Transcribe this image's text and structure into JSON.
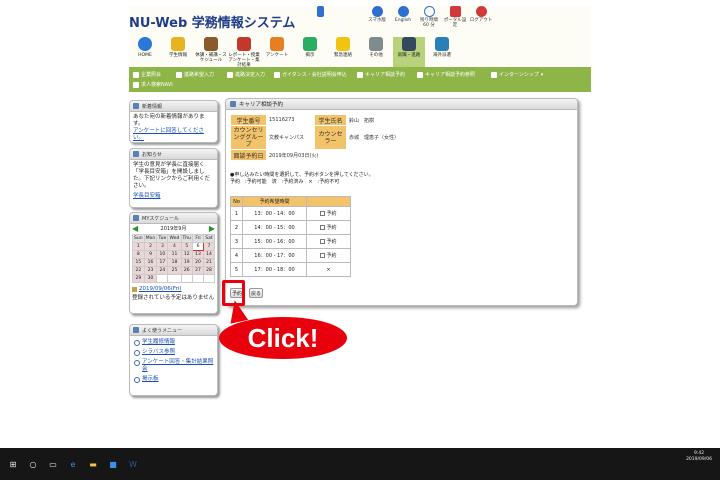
{
  "header": {
    "brand": "NU-Web 学務情報システム",
    "tools": [
      {
        "label": "スマホ版",
        "icon": "smartphone-icon",
        "color": "#2f6fd0"
      },
      {
        "label": "English",
        "icon": "globe-icon",
        "color": "#2f6fd0"
      },
      {
        "label": "残り時間 60 分",
        "icon": "clock-icon",
        "color": "#2f6fd0"
      },
      {
        "label": "ポータル設定",
        "icon": "portal-settings-icon",
        "color": "#d23a3a"
      },
      {
        "label": "ログアウト",
        "icon": "logout-icon",
        "color": "#d23a3a"
      }
    ],
    "nav": [
      {
        "label": "HOME",
        "icon": "home-icon",
        "color": "#2a78d8"
      },
      {
        "label": "学生情報",
        "icon": "student-info-icon",
        "color": "#e6b422"
      },
      {
        "label": "休講・補講・スケジュール",
        "icon": "schedule-icon",
        "color": "#8b5a2b"
      },
      {
        "label": "レポート・授業アンケート・集計結果",
        "icon": "report-icon",
        "color": "#c0392b"
      },
      {
        "label": "アンケート",
        "icon": "survey-icon",
        "color": "#e67e22"
      },
      {
        "label": "掲示",
        "icon": "notice-icon",
        "color": "#27ae60"
      },
      {
        "label": "緊急連絡",
        "icon": "emergency-icon",
        "color": "#f1c40f"
      },
      {
        "label": "その他",
        "icon": "other-icon",
        "color": "#7f8c8d"
      },
      {
        "label": "就職・進路",
        "icon": "career-icon",
        "color": "#34495e"
      },
      {
        "label": "海外派遣",
        "icon": "overseas-icon",
        "color": "#2980b9"
      }
    ]
  },
  "subnav": [
    "企業照会",
    "進路希望入力",
    "進路決定入力",
    "ガイダンス・会社説明会申込",
    "キャリア相談予約",
    "キャリア相談予約参照",
    "インターンシップ",
    "求人検索NAVI"
  ],
  "news": {
    "title": "新着情報",
    "text": "あなた宛の新着情報があります。",
    "link": "アンケートに回答してください。"
  },
  "notice": {
    "title": "お知らせ",
    "text": "学生の意見が学長に直接届く「学長目安箱」を開設しました。下記リンクからご利用ください。",
    "link": "学長目安箱"
  },
  "schedule": {
    "title": "MYスケジュール",
    "month": "2019年9月",
    "weekdays": [
      "Sun",
      "Mon",
      "Tue",
      "Wed",
      "Thu",
      "Fri",
      "Sat"
    ],
    "weeks": [
      [
        "1",
        "2",
        "3",
        "4",
        "5",
        "6",
        "7"
      ],
      [
        "8",
        "9",
        "10",
        "11",
        "12",
        "13",
        "14"
      ],
      [
        "15",
        "16",
        "17",
        "18",
        "19",
        "20",
        "21"
      ],
      [
        "22",
        "23",
        "24",
        "25",
        "26",
        "27",
        "28"
      ],
      [
        "29",
        "30",
        "",
        "",
        "",
        "",
        ""
      ]
    ],
    "date_link": "2019/09/06(Fri)",
    "empty_text": "登録されている予定はありません"
  },
  "menu": {
    "title": "よく使うメニュー",
    "items": [
      "学生履修情報",
      "シラバス参照",
      "アンケート回答・集計結果照会",
      "掲示板"
    ]
  },
  "main": {
    "title": "キャリア相談予約",
    "info": {
      "student_no_label": "学生番号",
      "student_no": "15116273",
      "name_label": "学生氏名",
      "name": "鈴山　拓樹",
      "group_label": "カウンセリンググループ",
      "group": "文教キャンパス",
      "counselor_label": "カウンセラー",
      "counselor": "赤城　理恵子（女性）",
      "date_label": "面談予約日",
      "date": "2019年09月03日(火)"
    },
    "note1": "●申し込みたい時間を選択して、予約ボタンを押してください。",
    "note2": "予約　:予約可能　済　:予約済み　×　:予約不可",
    "table_headers": [
      "No",
      "予約希望時間",
      ""
    ],
    "slots": [
      {
        "no": "1",
        "time": "13：00 - 14：00",
        "status": "予約"
      },
      {
        "no": "2",
        "time": "14：00 - 15：00",
        "status": "予約"
      },
      {
        "no": "3",
        "time": "15：00 - 16：00",
        "status": "予約"
      },
      {
        "no": "4",
        "time": "16：00 - 17：00",
        "status": "予約"
      },
      {
        "no": "5",
        "time": "17：00 - 18：00",
        "status": "×"
      }
    ],
    "reserve_button": "予約",
    "back_button": "戻る"
  },
  "callout": "Click!",
  "taskbar": {
    "time": "9:42",
    "date": "2019/09/06"
  }
}
